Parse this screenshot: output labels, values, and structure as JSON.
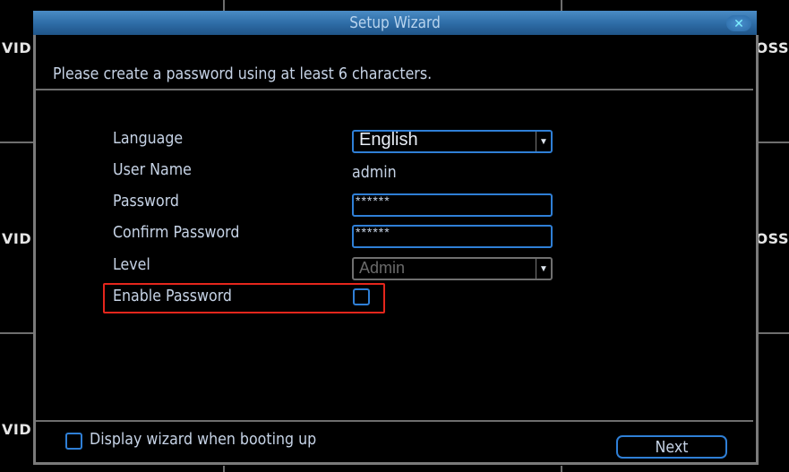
{
  "background": {
    "side_labels": [
      "VID",
      "VID",
      "VID",
      "OSS",
      "OSS"
    ]
  },
  "dialog": {
    "title": "Setup Wizard",
    "close_icon": "close-icon",
    "subtitle": "Please create a password using at least 6 characters.",
    "form": {
      "language": {
        "label": "Language",
        "value": "English"
      },
      "username": {
        "label": "User Name",
        "value": "admin"
      },
      "password": {
        "label": "Password",
        "value": "******"
      },
      "confirm_password": {
        "label": "Confirm Password",
        "value": "******"
      },
      "level": {
        "label": "Level",
        "value": "Admin",
        "disabled": true
      },
      "enable_password": {
        "label": "Enable Password",
        "checked": false
      }
    },
    "footer": {
      "display_wizard_label": "Display wizard when booting up",
      "display_wizard_checked": false,
      "next_label": "Next"
    }
  },
  "colors": {
    "accent": "#2f7fd6",
    "highlight": "#e5261c",
    "titlebar": "#2f6ea8"
  }
}
